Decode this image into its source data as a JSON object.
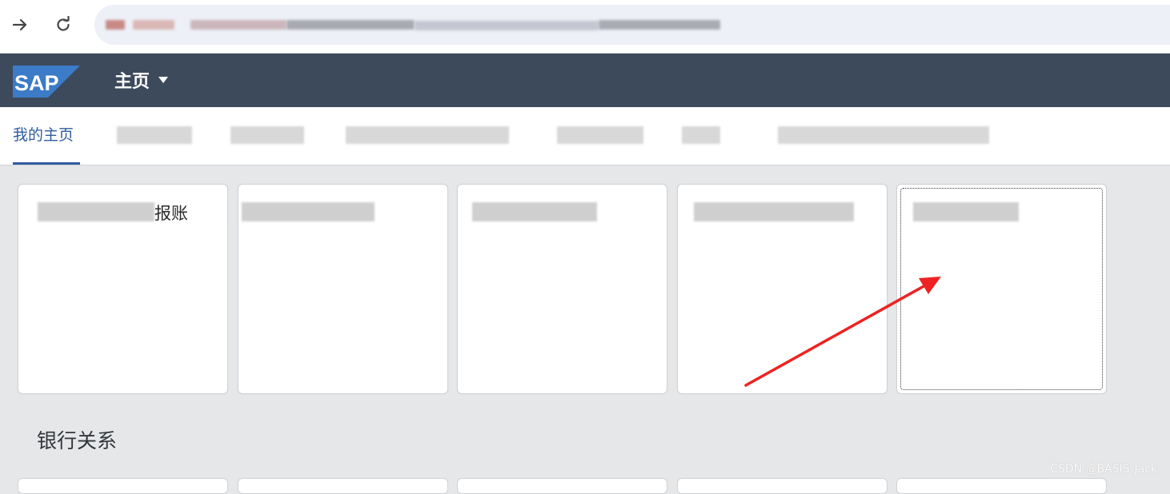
{
  "browser": {
    "forward_icon": "arrow-right-icon",
    "reload_icon": "reload-icon"
  },
  "shell": {
    "logo_text": "SAP",
    "home_title": "主页",
    "home_dropdown_icon": "caret-down-icon",
    "header_color": "#3d4a5c"
  },
  "anchor_bar": {
    "active_tab": "我的主页",
    "accent_color": "#2f5d9e"
  },
  "tiles": [
    {
      "visible_text": "报账"
    }
  ],
  "section": {
    "title": "银行关系"
  },
  "annotation": {
    "arrow_color": "#ee2222"
  },
  "watermark": "CSDN @BASIS-Jack"
}
